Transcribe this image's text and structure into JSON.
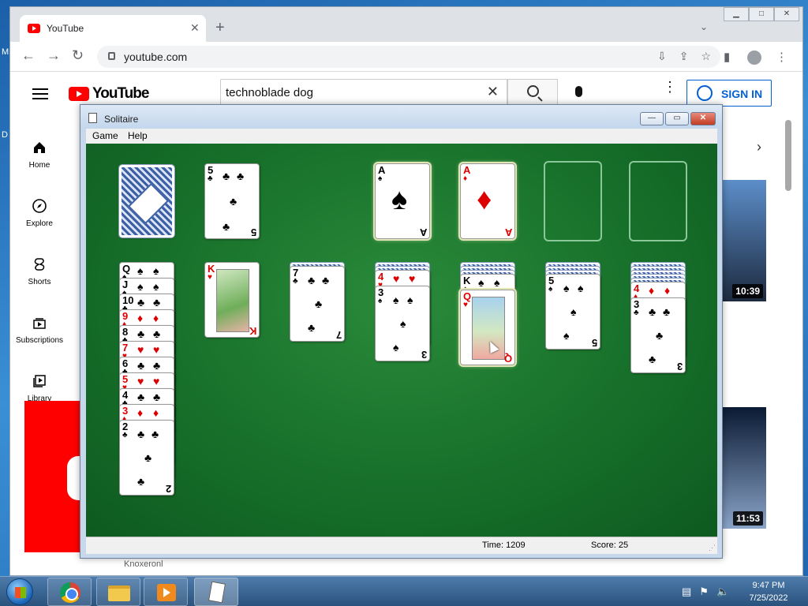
{
  "desktop": {
    "labels": [
      "M",
      "D"
    ]
  },
  "browser": {
    "tab_title": "YouTube",
    "tab_close": "✕",
    "new_tab": "+",
    "tab_search": "⌄",
    "url": "youtube.com",
    "back": "←",
    "forward": "→",
    "reload": "↻",
    "install": "⇩",
    "share": "⇪",
    "bookmark": "☆",
    "reader": "▮",
    "menu": "⋮",
    "window_buttons": [
      "▁",
      "□",
      "✕"
    ]
  },
  "youtube": {
    "logo_text": "YouTube",
    "search_query": "technoblade dog",
    "clear": "✕",
    "sign_in": "SIGN IN",
    "more": "⋮",
    "sidebar": [
      {
        "label": "Home"
      },
      {
        "label": "Explore"
      },
      {
        "label": "Shorts"
      },
      {
        "label": "Subscriptions"
      },
      {
        "label": "Library"
      }
    ],
    "chevron": "›",
    "durations": [
      "10:39",
      "11:53"
    ],
    "footer_text": "Knoxeronl"
  },
  "solitaire": {
    "title": "Solitaire",
    "window_buttons": [
      "—",
      "▭",
      "✕"
    ],
    "menu": [
      "Game",
      "Help"
    ],
    "time_label": "Time: 1209",
    "score_label": "Score: 25",
    "grip": "⋰",
    "stock_card": {
      "rank": "5",
      "suit": "♣",
      "color": "black"
    },
    "foundations": [
      {
        "rank": "A",
        "suit": "♠",
        "color": "black"
      },
      {
        "rank": "A",
        "suit": "♦",
        "color": "red"
      }
    ],
    "tableau": [
      {
        "column": 1,
        "hidden": 0,
        "cards": [
          "Q♠",
          "J♠",
          "10♣",
          "9♦",
          "8♣",
          "7♥",
          "6♣",
          "5♥",
          "4♣",
          "3♦",
          "2♣"
        ]
      },
      {
        "column": 2,
        "hidden": 0,
        "cards": [
          "K♥"
        ]
      },
      {
        "column": 3,
        "hidden": 1,
        "cards": [
          "7♣"
        ]
      },
      {
        "column": 4,
        "hidden": 2,
        "cards": [
          "4♥",
          "3♠"
        ]
      },
      {
        "column": 5,
        "hidden": 3,
        "cards": [
          "K♠",
          "Q♥"
        ]
      },
      {
        "column": 6,
        "hidden": 3,
        "cards": [
          "5♠"
        ]
      },
      {
        "column": 7,
        "hidden": 5,
        "cards": [
          "4♦",
          "3♣"
        ]
      }
    ]
  },
  "taskbar": {
    "clock_time": "9:47 PM",
    "clock_date": "7/25/2022",
    "tray_icons": [
      "▤",
      "⚑",
      "🔈"
    ]
  },
  "colors": {
    "felt": "#17702a",
    "youtube_red": "#ff0000",
    "signin_blue": "#065fd4",
    "card_red": "#dd0000"
  }
}
